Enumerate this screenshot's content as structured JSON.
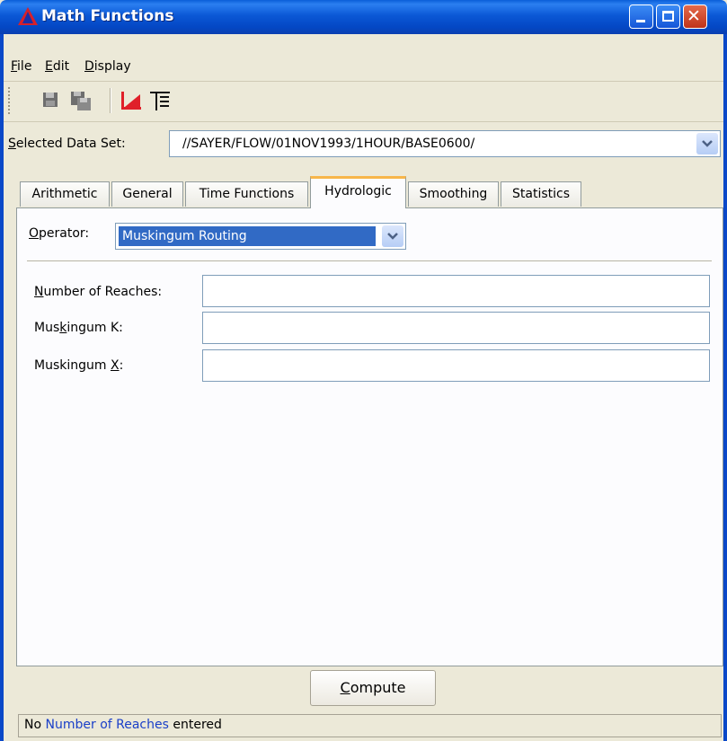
{
  "window": {
    "title": "Math Functions",
    "title_bar_color": "#0a5fd8",
    "icons": [
      "app-icon",
      "minimize-icon",
      "maximize-icon",
      "close-icon"
    ]
  },
  "menu": {
    "items": [
      {
        "label_first": "F",
        "label_rest": "ile"
      },
      {
        "label_first": "E",
        "label_rest": "dit"
      },
      {
        "label_first": "D",
        "label_rest": "isplay"
      }
    ]
  },
  "toolbar": {
    "icons": [
      "save-icon",
      "save-as-icon",
      "plot-icon",
      "table-icon"
    ]
  },
  "dataset": {
    "label_first": "S",
    "label_rest": "elected Data Set:",
    "value": "//SAYER/FLOW/01NOV1993/1HOUR/BASE0600/"
  },
  "tabs": [
    {
      "label": "Arithmetic",
      "active": false
    },
    {
      "label": "General",
      "active": false
    },
    {
      "label": "Time Functions",
      "active": false
    },
    {
      "label": "Hydrologic",
      "active": true
    },
    {
      "label": "Smoothing",
      "active": false
    },
    {
      "label": "Statistics",
      "active": false
    }
  ],
  "hydrologic": {
    "operator_label_first": "O",
    "operator_label_rest": "perator:",
    "operator_value": "Muskingum Routing",
    "fields": [
      {
        "label_pre": "",
        "label_u": "N",
        "label_post": "umber of Reaches:",
        "value": ""
      },
      {
        "label_pre": "Mus",
        "label_u": "k",
        "label_post": "ingum K:",
        "value": ""
      },
      {
        "label_pre": "Muskingum ",
        "label_u": "X",
        "label_post": ":",
        "value": ""
      }
    ]
  },
  "compute": {
    "label_first": "C",
    "label_rest": "ompute"
  },
  "status": {
    "prefix": "No ",
    "highlight": "Number of Reaches",
    "suffix": " entered",
    "highlight_color": "#1a3fc8"
  },
  "colors": {
    "selection": "#316ac5",
    "active_tab_accent": "#f7b64a",
    "window_face": "#ece9d8"
  }
}
